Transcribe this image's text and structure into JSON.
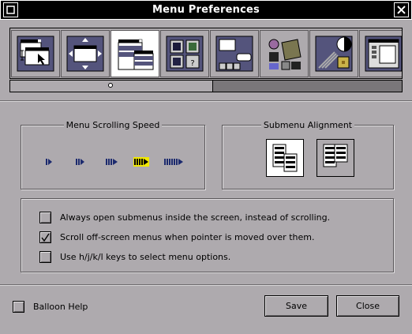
{
  "window": {
    "title": "Menu Preferences"
  },
  "icons": [
    {
      "name": "window-pointer-icon",
      "selected": false
    },
    {
      "name": "window-resize-icon",
      "selected": false
    },
    {
      "name": "menu-icon",
      "selected": true
    },
    {
      "name": "applications-icon",
      "selected": false
    },
    {
      "name": "dock-icon",
      "selected": false
    },
    {
      "name": "workspace-icon",
      "selected": false
    },
    {
      "name": "appearance-icon",
      "selected": false
    },
    {
      "name": "expert-icon",
      "selected": false
    }
  ],
  "scrolling": {
    "title": "Menu Scrolling Speed",
    "levels": 5,
    "selected_index": 3
  },
  "alignment": {
    "title": "Submenu Alignment",
    "options": [
      "aligned",
      "tiled"
    ],
    "selected_index": 0
  },
  "options": [
    {
      "label": "Always open submenus inside the screen, instead of scrolling.",
      "checked": false
    },
    {
      "label": "Scroll off-screen menus when pointer is moved over them.",
      "checked": true
    },
    {
      "label": "Use h/j/k/l keys to select menu options.",
      "checked": false
    }
  ],
  "footer": {
    "balloon_help": "Balloon Help",
    "balloon_checked": false,
    "save": "Save",
    "close": "Close"
  },
  "colors": {
    "background": "#aeaaae",
    "titlebar": "#000000",
    "speed_arrow": "#1c2a6e",
    "speed_selected": "#f0e800",
    "icon_fill": "#54547c"
  }
}
